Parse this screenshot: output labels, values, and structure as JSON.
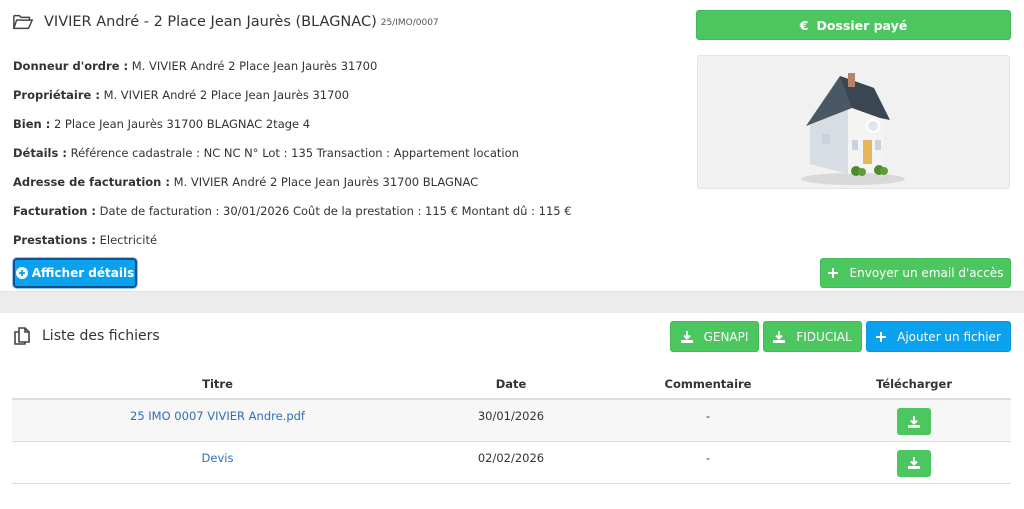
{
  "dossier": {
    "title": "VIVIER André - 2 Place Jean Jaurès (BLAGNAC)",
    "reference": "25/IMO/0007",
    "paid_label": "Dossier payé",
    "details_button": "Afficher détails",
    "email_button": "Envoyer un email d'accès",
    "info": [
      {
        "label": "Donneur d'ordre :",
        "value": " M. VIVIER André 2 Place Jean Jaurès 31700"
      },
      {
        "label": "Propriétaire :",
        "value": " M. VIVIER André 2 Place Jean Jaurès 31700"
      },
      {
        "label": "Bien :",
        "value": " 2 Place Jean Jaurès 31700 BLAGNAC 2tage 4"
      },
      {
        "label": "Détails :",
        "value": " Référence cadastrale : NC NC N° Lot : 135 Transaction : Appartement location"
      },
      {
        "label": "Adresse de facturation :",
        "value": " M. VIVIER André 2 Place Jean Jaurès 31700 BLAGNAC"
      },
      {
        "label": "Facturation :",
        "value": " Date de facturation : 30/01/2026 Coût de la prestation : 115 € Montant dû : 115 €"
      },
      {
        "label": "Prestations :",
        "value": " Electricité"
      }
    ]
  },
  "files": {
    "title": "Liste des fichiers",
    "genapi_button": "GENAPI",
    "fiducial_button": "FIDUCIAL",
    "add_button": "Ajouter un fichier",
    "columns": [
      "Titre",
      "Date",
      "Commentaire",
      "Télécharger"
    ],
    "rows": [
      {
        "title": "25 IMO 0007 VIVIER Andre.pdf",
        "date": "30/01/2026",
        "comment": "-"
      },
      {
        "title": "Devis",
        "date": "02/02/2026",
        "comment": "-"
      }
    ]
  },
  "colors": {
    "green": "#4cc75f",
    "blue": "#0aa2ef",
    "link": "#2f6eb5"
  },
  "icons": [
    "folder-open-icon",
    "euro-icon",
    "plus-circle-icon",
    "plus-icon",
    "files-icon",
    "download-icon",
    "house-image"
  ]
}
